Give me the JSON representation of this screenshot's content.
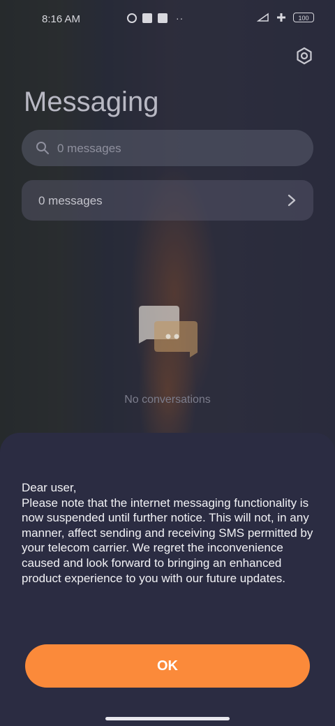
{
  "status_bar": {
    "time": "8:16 AM",
    "battery": "100"
  },
  "header": {
    "title": "Messaging",
    "settings_icon": "gear-icon"
  },
  "search": {
    "placeholder": "0 messages",
    "icon": "search-icon"
  },
  "messages_row": {
    "label": "0 messages",
    "icon": "chevron-right-icon"
  },
  "empty_state": {
    "icon": "chat-bubbles-icon",
    "text": "No conversations"
  },
  "dialog": {
    "message": "Dear user,\nPlease note that the internet messaging functionality is now suspended until further notice. This will not, in any manner, affect sending and receiving SMS permitted by your telecom carrier. We regret the inconvenience caused and look forward to bringing an enhanced product experience to you with our future updates.",
    "ok_label": "OK"
  },
  "colors": {
    "accent": "#fb8a3a",
    "sheet_bg": "#2b2c42"
  }
}
